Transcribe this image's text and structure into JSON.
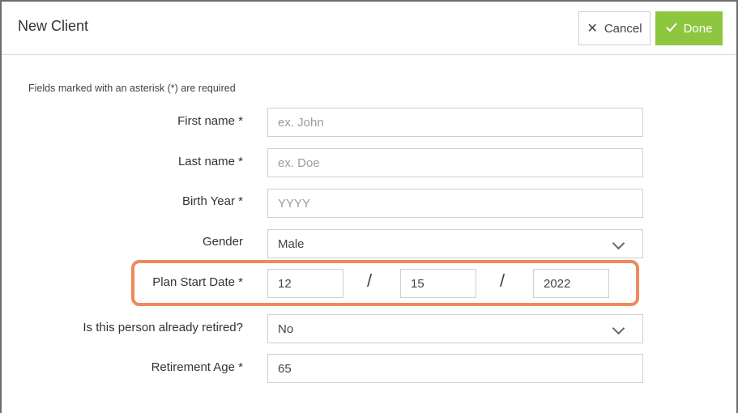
{
  "header": {
    "title": "New Client",
    "cancel_label": "Cancel",
    "done_label": "Done"
  },
  "form": {
    "required_note": "Fields marked with an asterisk (*) are required",
    "first_name": {
      "label": "First name *",
      "placeholder": "ex. John",
      "value": ""
    },
    "last_name": {
      "label": "Last name *",
      "placeholder": "ex. Doe",
      "value": ""
    },
    "birth_year": {
      "label": "Birth Year *",
      "placeholder": "YYYY",
      "value": ""
    },
    "gender": {
      "label": "Gender",
      "value": "Male"
    },
    "plan_start_date": {
      "label": "Plan Start Date *",
      "month": "12",
      "day": "15",
      "year": "2022",
      "separator": "/"
    },
    "retired": {
      "label": "Is this person already retired?",
      "value": "No"
    },
    "retirement_age": {
      "label": "Retirement Age *",
      "value": "65"
    }
  },
  "colors": {
    "accent": "#8dc63f",
    "highlight": "#ee8a5e"
  }
}
